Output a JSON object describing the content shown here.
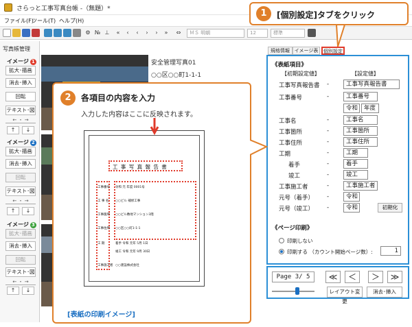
{
  "window": {
    "title": "さらっと工事写真台帳 -（無題）*"
  },
  "menu": [
    "ファイル(F)",
    "ツール(T)",
    "ヘルプ(H)"
  ],
  "toolbar": {
    "font_name": "ＭＳ 明朝",
    "font_size": "12",
    "style": "標準"
  },
  "left_panel": {
    "header": "写真帳管理",
    "groups": [
      {
        "label": "イメージ",
        "num": "1",
        "num_color": "#e03a2a"
      },
      {
        "label": "イメージ",
        "num": "2",
        "num_color": "#1a6fc2"
      },
      {
        "label": "イメージ",
        "num": "3",
        "num_color": "#3aa03a"
      }
    ],
    "buttons": {
      "enlarge": "拡大･描画",
      "erase": "消去･挿入",
      "rotate": "回転",
      "text": "テキスト･図"
    }
  },
  "photo_text": {
    "line1": "安全管理写真01",
    "line2": "○○区○○町1-1-1"
  },
  "tabs": [
    "規格情報",
    "イメージ表示",
    "個別設定"
  ],
  "panel": {
    "section_title": "《表紙項目》",
    "col_initial": "【初期設定値】",
    "col_setting": "【設定値】",
    "dash": "-",
    "rows": [
      {
        "label": "工事写真報告書",
        "value": "工事写真報告書"
      },
      {
        "label": "工事番号",
        "value": "工事番号"
      },
      {
        "label": "工事名",
        "value": "工事名"
      },
      {
        "label": "工事箇所",
        "value": "工事箇所"
      },
      {
        "label": "工事住所",
        "value": "工事住所"
      },
      {
        "label": "工期",
        "value": "工期"
      },
      {
        "label": "着手",
        "value": "着手"
      },
      {
        "label": "竣工",
        "value": "竣工"
      },
      {
        "label": "工事施工者",
        "value": "工事施工者"
      },
      {
        "label": "元号（着手）",
        "value": "令和"
      },
      {
        "label": "元号（竣工）",
        "value": "令和"
      }
    ],
    "era_value": "令和",
    "year_value": "年度",
    "reset_label": "初期化",
    "page_print_title": "《ページ印刷》",
    "print_off": "印刷しない",
    "print_on": "印刷する （カウント開始ページ数）:",
    "start_page": "1"
  },
  "nav": {
    "page": "Page 3/ 5",
    "first": "≪",
    "prev": "＜",
    "next": "＞",
    "last": "≫",
    "layout": "レイアウト変更",
    "erase": "消去･挿入"
  },
  "callout1": {
    "num": "1",
    "text": "[個別設定]タブをクリック"
  },
  "callout2": {
    "num": "2",
    "title": "各項目の内容を入力",
    "sub": "入力した内容はここに反映されます。",
    "caption": "[表紙の印刷イメージ]",
    "sheet_title": "工 事 写 真 報 告 書",
    "sheet_rows": [
      {
        "label": "工事番号",
        "value": "令和 元 年度 0001号"
      },
      {
        "label": "工 事 名",
        "value": "○○ビル 補修工事"
      },
      {
        "label": "工事箇所",
        "value": "○○ビル敷地マンション3階"
      },
      {
        "label": "工事住所",
        "value": "○○区○○町1-1-1"
      },
      {
        "label": "工 期",
        "value": "着手 令和 元年 5月 1日"
      },
      {
        "label": "",
        "value": "竣工 令和 元年 9月 30日"
      },
      {
        "label": "工事施工者",
        "value": "○○建設株式会社"
      }
    ]
  },
  "colors": {
    "accent": "#e0802a",
    "panel_border": "#2b8fd6",
    "marker": "#e03a2a"
  }
}
